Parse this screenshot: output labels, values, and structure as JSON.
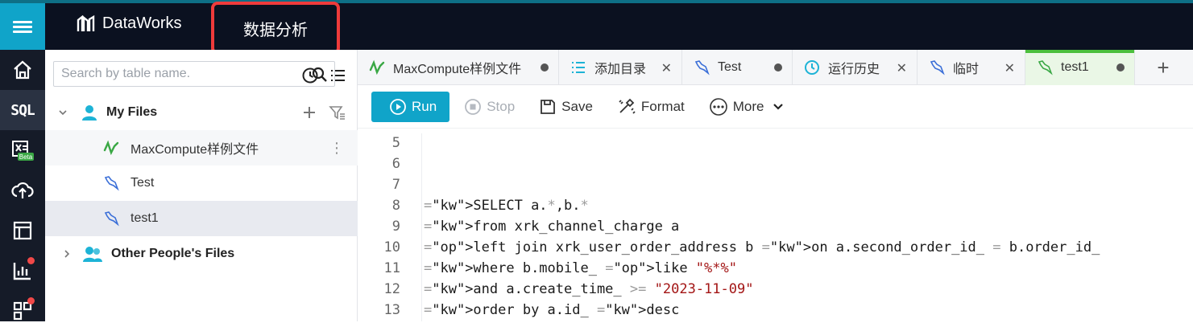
{
  "app": {
    "name": "DataWorks",
    "module": "数据分析"
  },
  "sidebar": {
    "items": [
      {
        "name": "home-icon"
      },
      {
        "name": "sql",
        "label": "SQL"
      },
      {
        "name": "excel-beta-icon",
        "badge": "Beta"
      },
      {
        "name": "cloud-upload-icon"
      },
      {
        "name": "layout-icon"
      },
      {
        "name": "bar-chart-icon"
      },
      {
        "name": "apps-icon"
      }
    ]
  },
  "tree": {
    "search_placeholder": "Search by table name.",
    "my_files": "My Files",
    "files": [
      "MaxCompute样例文件",
      "Test",
      "test1"
    ],
    "other_files": "Other People's Files"
  },
  "tabs": [
    {
      "label": "MaxCompute样例文件",
      "marker": "dot"
    },
    {
      "label": "添加目录",
      "marker": "close"
    },
    {
      "label": "Test",
      "marker": "dot"
    },
    {
      "label": "运行历史",
      "marker": "close"
    },
    {
      "label": "临时",
      "marker": "close"
    },
    {
      "label": "test1",
      "marker": "dot",
      "active": true
    }
  ],
  "toolbar": {
    "run": "Run",
    "stop": "Stop",
    "save": "Save",
    "format": "Format",
    "more": "More"
  },
  "code": {
    "line_numbers": [
      "5",
      "6",
      "7",
      "8",
      "9",
      "10",
      "11",
      "12",
      "13"
    ],
    "lines": [
      "",
      "",
      "",
      "SELECT a.*,b.*",
      "from xrk_channel_charge a",
      "left join xrk_user_order_address b on a.second_order_id_ = b.order_id_",
      "where b.mobile_ like \"%*%\"",
      "and a.create_time_ >= \"2023-11-09\"",
      "order by a.id_ desc"
    ]
  },
  "colors": {
    "accent": "#10a4c9",
    "highlight": "#ef3b3b",
    "active_tab": "#4bbf3c"
  }
}
